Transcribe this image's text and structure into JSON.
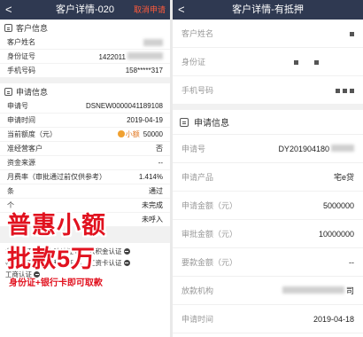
{
  "left": {
    "nav": {
      "back": "<",
      "title": "客户详情-020",
      "action": "取消申请"
    },
    "customer_section": "客户信息",
    "customer_rows": [
      {
        "label": "客户姓名",
        "value": ""
      },
      {
        "label": "身份证号",
        "value": "1422011"
      },
      {
        "label": "手机号码",
        "value": "158*****317"
      }
    ],
    "apply_section": "申请信息",
    "apply_rows": [
      {
        "label": "申请号",
        "value": "DSNEW0000041189108"
      },
      {
        "label": "申请时间",
        "value": "2019-04-19"
      },
      {
        "label": "当前额度（元）",
        "value": "50000",
        "badge": "小额"
      },
      {
        "label": "准经营客户",
        "value": "否"
      },
      {
        "label": "资金来源",
        "value": "--"
      },
      {
        "label": "月费率（审批通过前仅供参考）",
        "value": "1.414%"
      },
      {
        "label": "条",
        "value": "通过"
      },
      {
        "label": "个",
        "value": "未完成"
      },
      {
        "label": "个",
        "value": "未呼入"
      }
    ],
    "auth_rows": [
      [
        "车辆认证",
        "寿险认证",
        "公积金认证"
      ],
      [
        "社保认证",
        "个税认证",
        "工资卡认证"
      ],
      [
        "工商认证"
      ]
    ],
    "promo": {
      "line1": "普惠小额",
      "line2": "批款5万",
      "line3": "身份证+银行卡即可取款"
    }
  },
  "right": {
    "nav": {
      "back": "<",
      "title": "客户详情-有抵押"
    },
    "customer_rows": [
      {
        "label": "客户姓名",
        "value": ""
      },
      {
        "label": "身份证",
        "value": ""
      },
      {
        "label": "手机号码",
        "value": ""
      }
    ],
    "apply_section": "申请信息",
    "apply_rows": [
      {
        "label": "申请号",
        "value": "DY201904180"
      },
      {
        "label": "申请产品",
        "value": "宅e贷"
      },
      {
        "label": "申请金额（元）",
        "value": "5000000"
      },
      {
        "label": "审批金额（元）",
        "value": "10000000"
      },
      {
        "label": "要款金额（元）",
        "value": "--"
      },
      {
        "label": "放款机构",
        "value": "司"
      },
      {
        "label": "申请时间",
        "value": "2019-04-18"
      }
    ]
  }
}
